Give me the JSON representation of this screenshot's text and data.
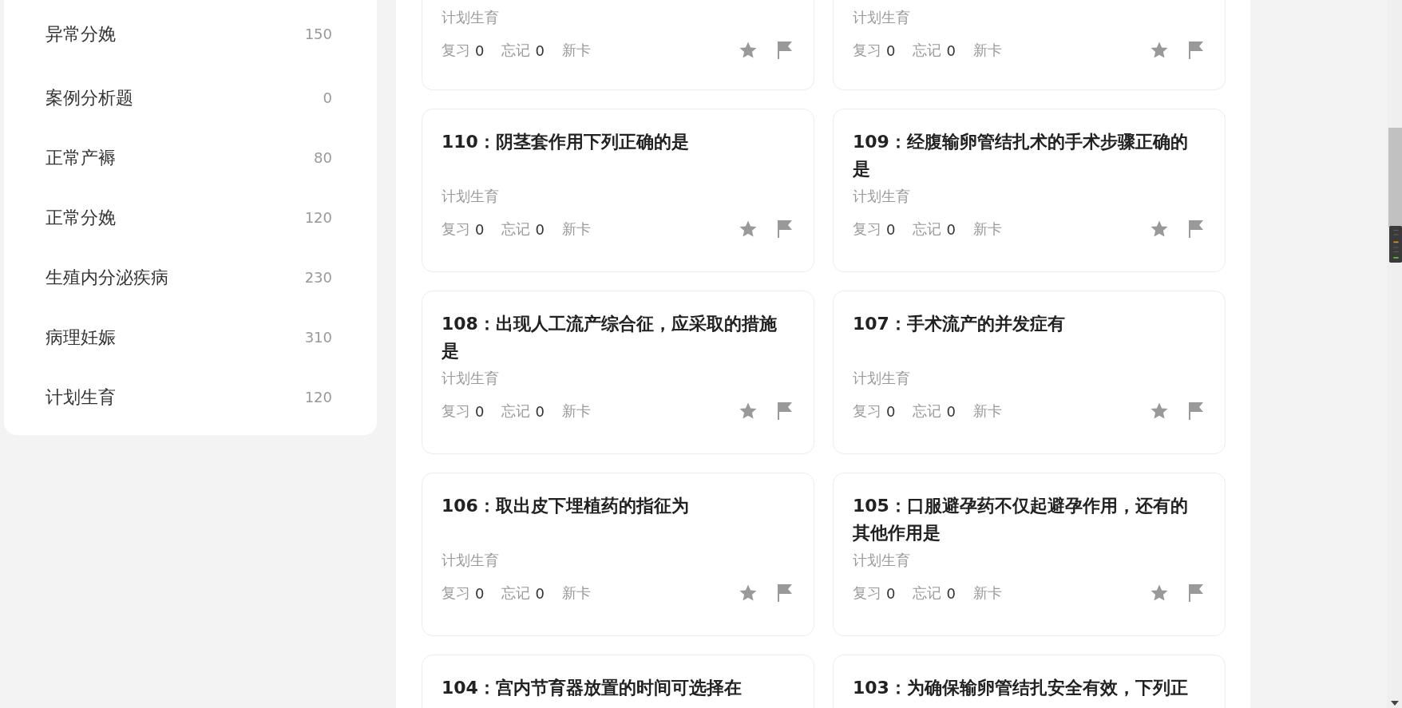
{
  "sidebar": {
    "items": [
      {
        "label": "异常分娩",
        "count": "150"
      },
      {
        "label": "案例分析题",
        "count": "0"
      },
      {
        "label": "正常产褥",
        "count": "80"
      },
      {
        "label": "正常分娩",
        "count": "120"
      },
      {
        "label": "生殖内分泌疾病",
        "count": "230"
      },
      {
        "label": "病理妊娠",
        "count": "310"
      },
      {
        "label": "计划生育",
        "count": "120"
      }
    ]
  },
  "cards": [
    {
      "subject": "计划生育",
      "stats": [
        {
          "label": "复习",
          "value": "0"
        },
        {
          "label": "忘记",
          "value": "0"
        },
        {
          "label": "新卡"
        }
      ]
    },
    {
      "subject": "计划生育",
      "stats": [
        {
          "label": "复习",
          "value": "0"
        },
        {
          "label": "忘记",
          "value": "0"
        },
        {
          "label": "新卡"
        }
      ]
    },
    {
      "title": "110：阴茎套作用下列正确的是",
      "subject": "计划生育",
      "stats": [
        {
          "label": "复习",
          "value": "0"
        },
        {
          "label": "忘记",
          "value": "0"
        },
        {
          "label": "新卡"
        }
      ]
    },
    {
      "title": "109：经腹输卵管结扎术的手术步骤正确的是",
      "subject": "计划生育",
      "stats": [
        {
          "label": "复习",
          "value": "0"
        },
        {
          "label": "忘记",
          "value": "0"
        },
        {
          "label": "新卡"
        }
      ]
    },
    {
      "title": "108：出现人工流产综合征，应采取的措施是",
      "subject": "计划生育",
      "stats": [
        {
          "label": "复习",
          "value": "0"
        },
        {
          "label": "忘记",
          "value": "0"
        },
        {
          "label": "新卡"
        }
      ]
    },
    {
      "title": "107：手术流产的并发症有",
      "subject": "计划生育",
      "stats": [
        {
          "label": "复习",
          "value": "0"
        },
        {
          "label": "忘记",
          "value": "0"
        },
        {
          "label": "新卡"
        }
      ]
    },
    {
      "title": "106：取出皮下埋植药的指征为",
      "subject": "计划生育",
      "stats": [
        {
          "label": "复习",
          "value": "0"
        },
        {
          "label": "忘记",
          "value": "0"
        },
        {
          "label": "新卡"
        }
      ]
    },
    {
      "title": "105：口服避孕药不仅起避孕作用，还有的其他作用是",
      "subject": "计划生育",
      "stats": [
        {
          "label": "复习",
          "value": "0"
        },
        {
          "label": "忘记",
          "value": "0"
        },
        {
          "label": "新卡"
        }
      ]
    },
    {
      "title": "104：宫内节育器放置的时间可选择在"
    },
    {
      "title": "103：为确保输卵管结扎安全有效，下列正"
    }
  ]
}
